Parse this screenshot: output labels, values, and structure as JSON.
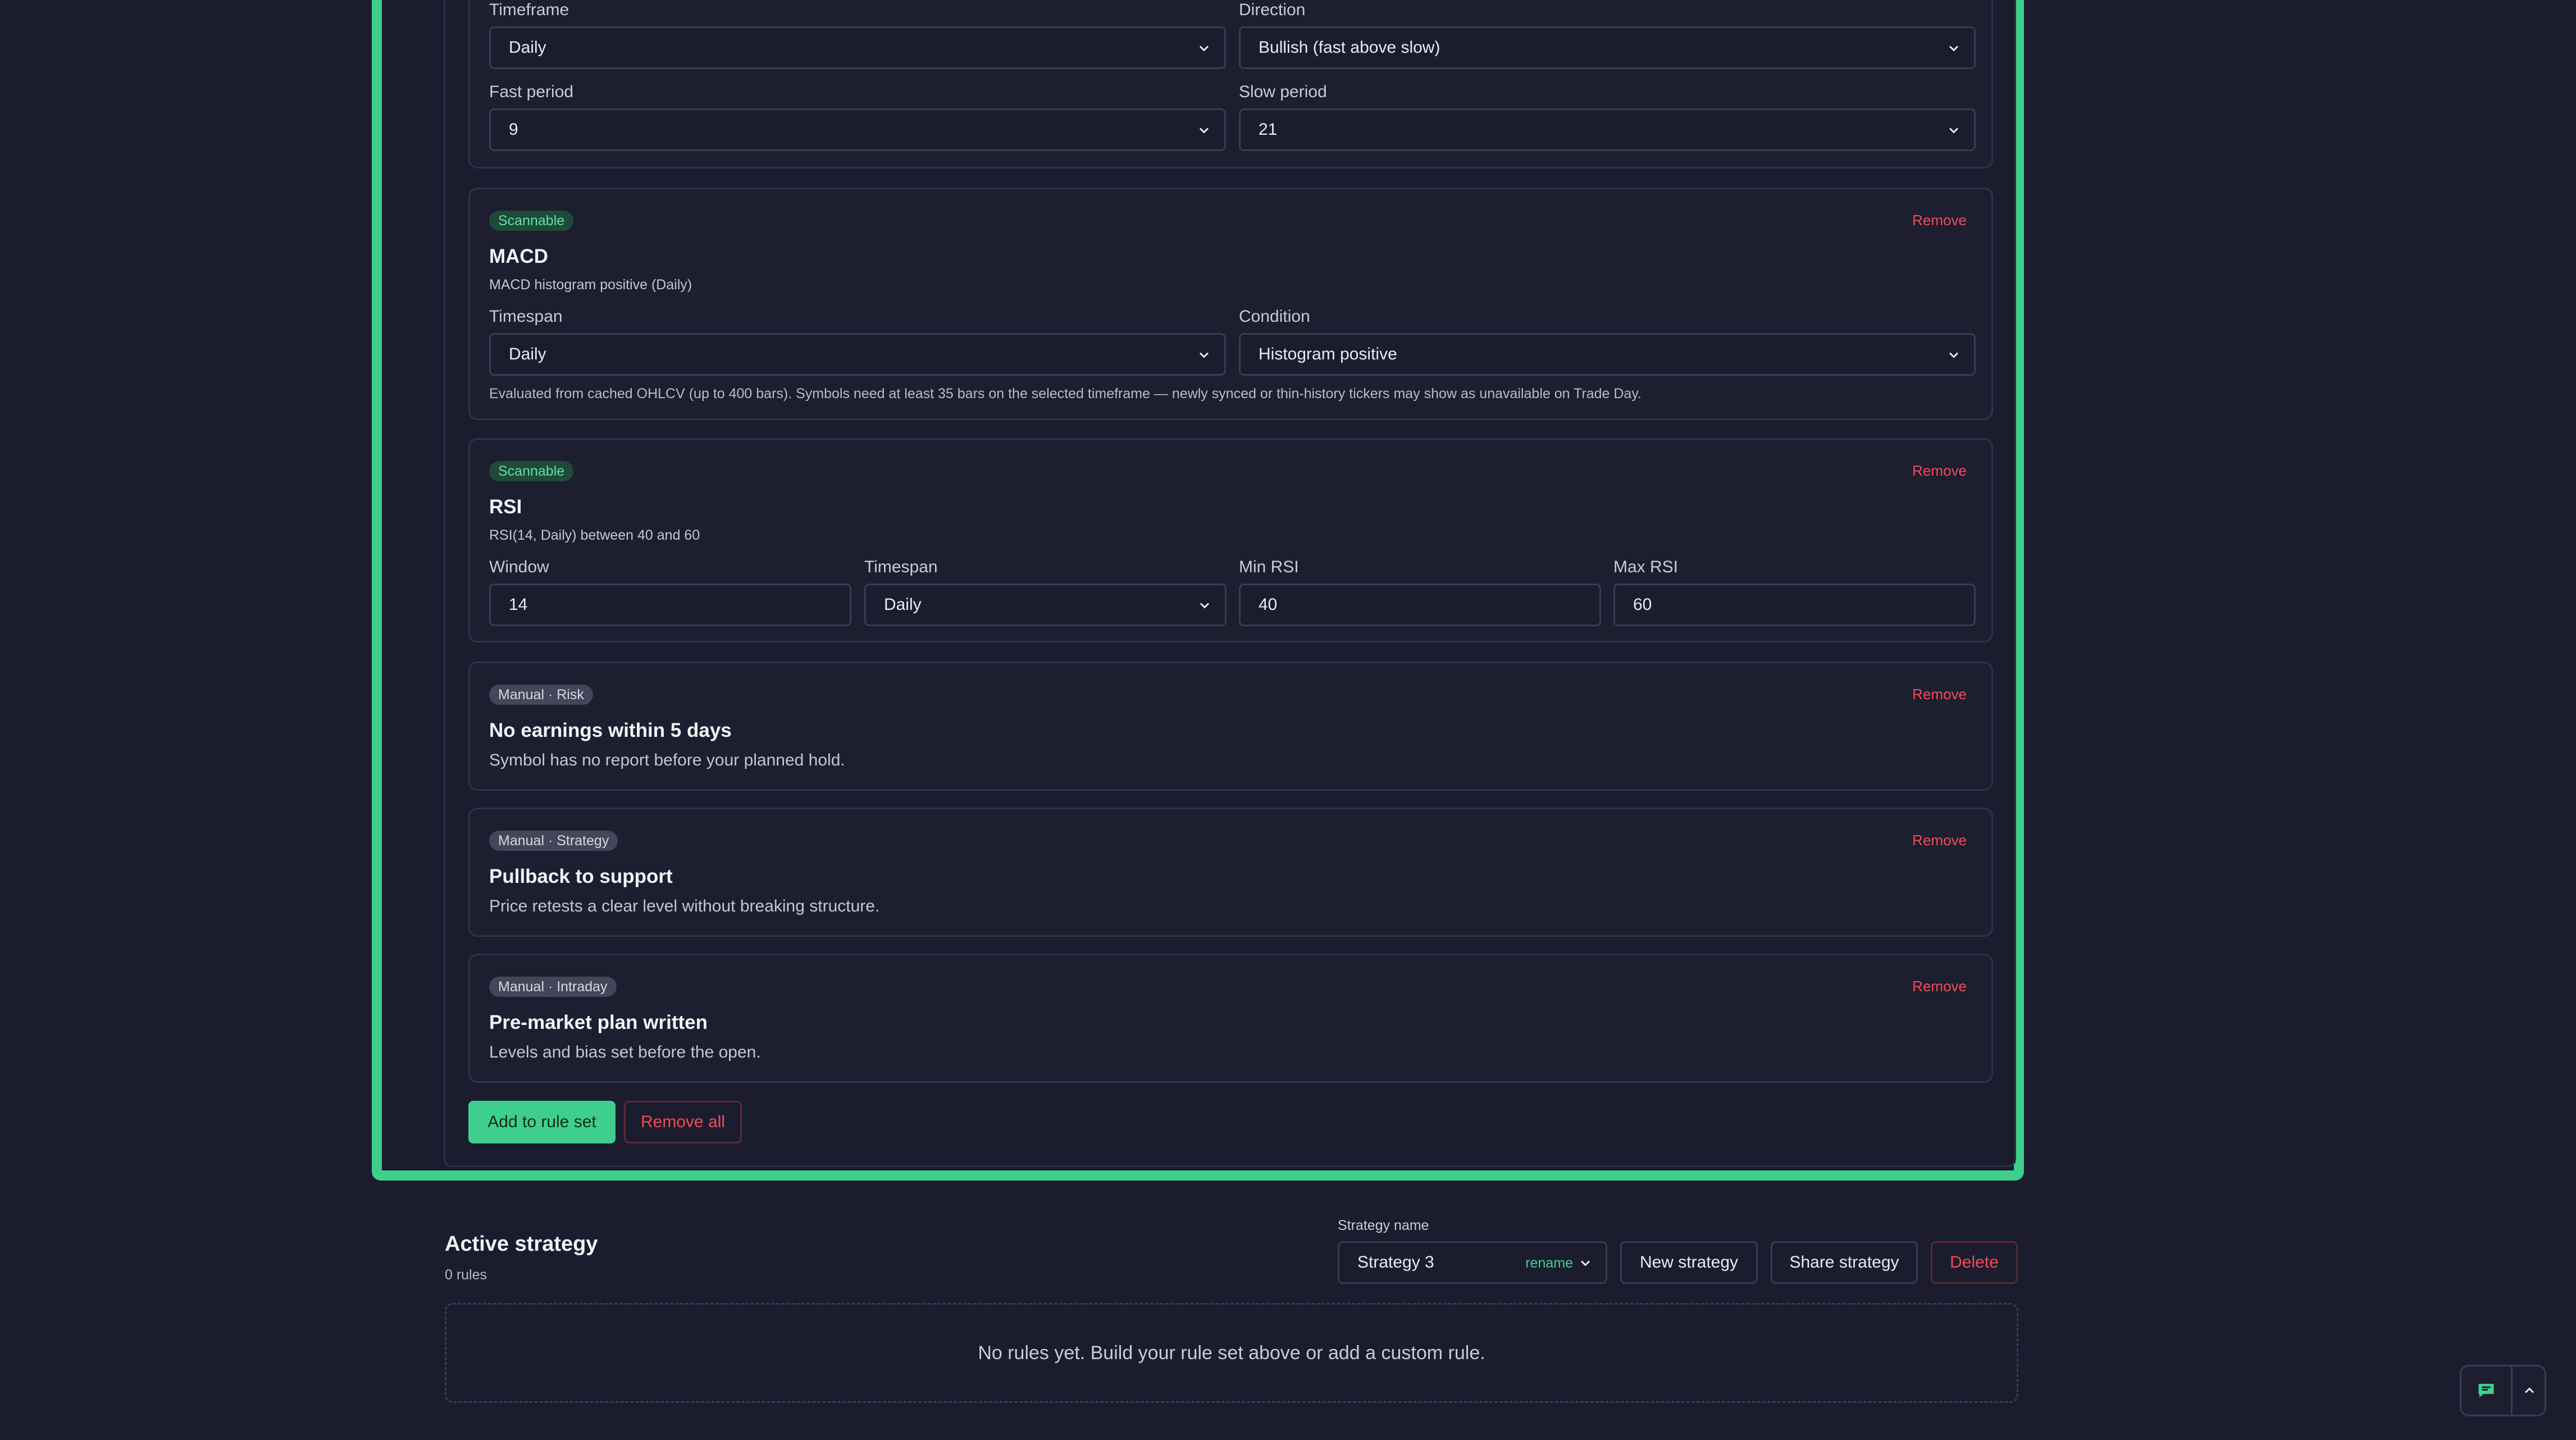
{
  "ma_card": {
    "timeframe_label": "Timeframe",
    "timeframe_value": "Daily",
    "direction_label": "Direction",
    "direction_value": "Bullish (fast above slow)",
    "fast_label": "Fast period",
    "fast_value": "9",
    "slow_label": "Slow period",
    "slow_value": "21"
  },
  "macd_card": {
    "badge": "Scannable",
    "remove": "Remove",
    "title": "MACD",
    "subtitle": "MACD histogram positive (Daily)",
    "timespan_label": "Timespan",
    "timespan_value": "Daily",
    "condition_label": "Condition",
    "condition_value": "Histogram positive",
    "note": "Evaluated from cached OHLCV (up to 400 bars). Symbols need at least 35 bars on the selected timeframe — newly synced or thin-history tickers may show as unavailable on Trade Day."
  },
  "rsi_card": {
    "badge": "Scannable",
    "remove": "Remove",
    "title": "RSI",
    "subtitle": "RSI(14, Daily) between 40 and 60",
    "window_label": "Window",
    "window_value": "14",
    "timespan_label": "Timespan",
    "timespan_value": "Daily",
    "min_label": "Min RSI",
    "min_value": "40",
    "max_label": "Max RSI",
    "max_value": "60"
  },
  "manual_cards": [
    {
      "badge": "Manual · Risk",
      "remove": "Remove",
      "title": "No earnings within 5 days",
      "desc": "Symbol has no report before your planned hold."
    },
    {
      "badge": "Manual · Strategy",
      "remove": "Remove",
      "title": "Pullback to support",
      "desc": "Price retests a clear level without breaking structure."
    },
    {
      "badge": "Manual · Intraday",
      "remove": "Remove",
      "title": "Pre-market plan written",
      "desc": "Levels and bias set before the open."
    }
  ],
  "actions": {
    "add": "Add to rule set",
    "remove_all": "Remove all"
  },
  "active": {
    "title": "Active strategy",
    "count": "0 rules",
    "name_label": "Strategy name",
    "name_value": "Strategy 3",
    "rename": "rename",
    "new": "New strategy",
    "share": "Share strategy",
    "delete": "Delete",
    "empty": "No rules yet. Build your rule set above or add a custom rule."
  },
  "colors": {
    "accent": "#3ecf8e",
    "danger": "#ef4c5a",
    "background": "#1b1c2e"
  },
  "icons": {
    "chevron": "chevron-down-icon",
    "chat": "chat-icon",
    "up": "chevron-up-icon"
  }
}
